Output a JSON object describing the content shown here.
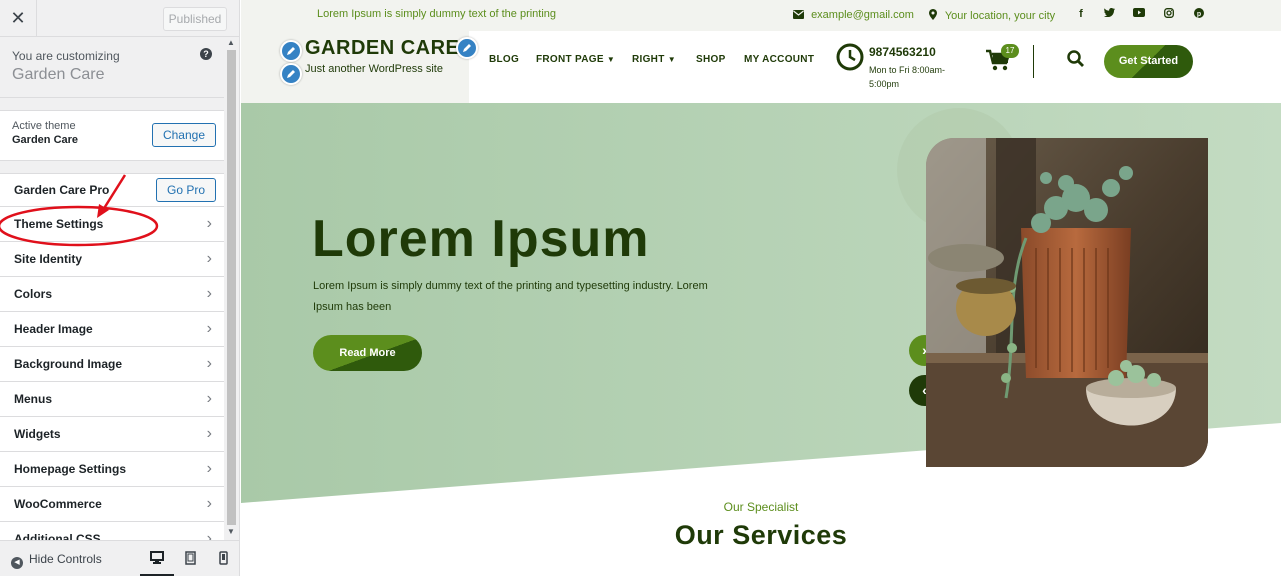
{
  "customizer": {
    "published_label": "Published",
    "customizing_label": "You are customizing",
    "site_name": "Garden Care",
    "active_theme_label": "Active theme",
    "active_theme_name": "Garden Care",
    "change_label": "Change",
    "pro_label": "Garden Care Pro",
    "go_pro_label": "Go Pro",
    "sections": [
      {
        "label": "Theme Settings"
      },
      {
        "label": "Site Identity"
      },
      {
        "label": "Colors"
      },
      {
        "label": "Header Image"
      },
      {
        "label": "Background Image"
      },
      {
        "label": "Menus"
      },
      {
        "label": "Widgets"
      },
      {
        "label": "Homepage Settings"
      },
      {
        "label": "WooCommerce"
      },
      {
        "label": "Additional CSS"
      }
    ],
    "hide_controls_label": "Hide Controls",
    "annotation_color": "#e0101b"
  },
  "site": {
    "topbar": {
      "tagline": "Lorem Ipsum is simply dummy text of the printing",
      "email": "example@gmail.com",
      "location": "Your location, your city",
      "social_icons": [
        "facebook-icon",
        "twitter-icon",
        "youtube-icon",
        "instagram-icon",
        "pinterest-icon"
      ]
    },
    "logo": {
      "title": "GARDEN CARE",
      "subtitle": "Just another WordPress site"
    },
    "nav": {
      "blog": "BLOG",
      "front_page": "FRONT PAGE",
      "right": "RIGHT",
      "shop": "SHOP",
      "my_account": "MY ACCOUNT"
    },
    "phone": {
      "number": "9874563210",
      "hours": "Mon to Fri 8:00am-5:00pm"
    },
    "cart_count": "17",
    "cta_label": "Get Started",
    "hero": {
      "title": "Lorem Ipsum",
      "description": "Lorem Ipsum is simply dummy text of the printing and typesetting industry. Lorem Ipsum has been",
      "button_label": "Read More"
    },
    "services": {
      "subtitle": "Our Specialist",
      "title": "Our Services"
    },
    "colors": {
      "primary_green": "#5c8e1d",
      "dark_green": "#1f3a08",
      "hero_bg": "#a9c9a8",
      "topbar_bg": "#f2f3ef"
    }
  }
}
